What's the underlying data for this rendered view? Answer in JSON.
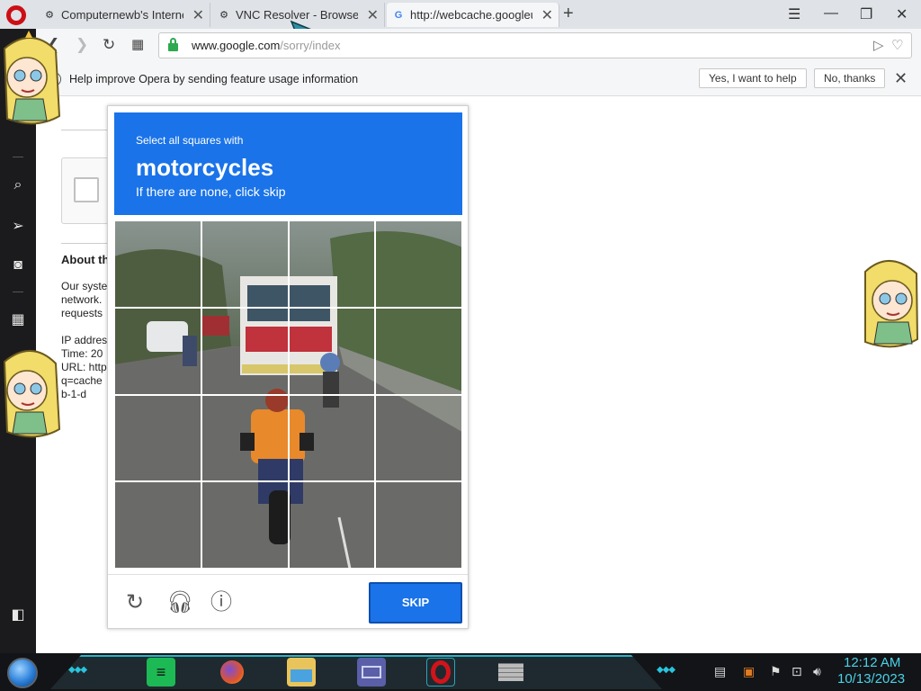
{
  "tabs": [
    {
      "title": "Computernewb's Internet",
      "favicon": "vm-icon",
      "active": false
    },
    {
      "title": "VNC Resolver - Browse",
      "favicon": "vm-icon",
      "active": false
    },
    {
      "title": "http://webcache.googleus",
      "favicon": "google-icon",
      "active": true
    }
  ],
  "address": {
    "host": "www.google.com",
    "path": "/sorry/index"
  },
  "infobar": {
    "message": "Help improve Opera by sending feature usage information",
    "accept_label": "Yes, I want to help",
    "decline_label": "No, thanks"
  },
  "page": {
    "about_title": "About th",
    "lines": [
      "Our syste",
      "network.",
      "requests",
      "",
      "IP addres",
      "Time: 20",
      "URL: http",
      "q=cache",
      "b-1-d"
    ]
  },
  "captcha": {
    "instruction": "Select all squares with",
    "target": "motorcycles",
    "hint": "If there are none, click skip",
    "skip_label": "SKIP",
    "footer_icons": [
      "reload-icon",
      "headphones-icon",
      "info-icon"
    ]
  },
  "taskbar": {
    "time": "12:12 AM",
    "date": "10/13/2023"
  },
  "colors": {
    "captcha_blue": "#1a73e8",
    "sidebar": "#1b1b1d",
    "opera_red": "#cc0f16",
    "clock": "#4ad2e8"
  }
}
